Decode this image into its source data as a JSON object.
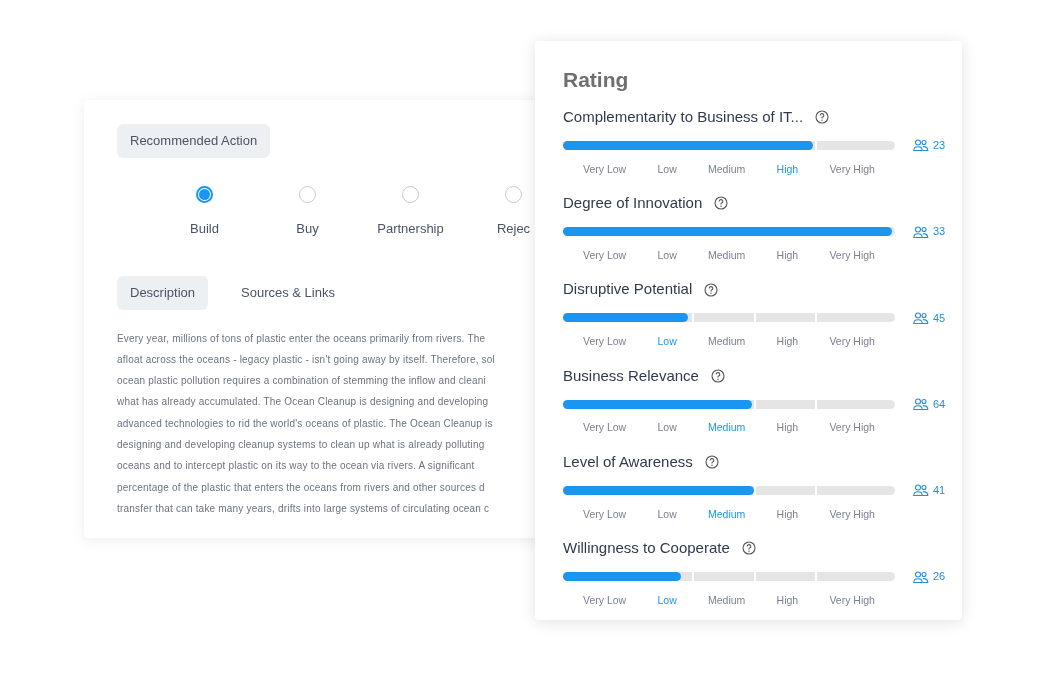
{
  "action_card": {
    "heading": "Recommended Action",
    "options": [
      {
        "label": "Build",
        "selected": true
      },
      {
        "label": "Buy",
        "selected": false
      },
      {
        "label": "Partnership",
        "selected": false
      },
      {
        "label": "Rejec",
        "selected": false
      }
    ],
    "tabs": [
      {
        "label": "Description",
        "selected": true
      },
      {
        "label": "Sources & Links",
        "selected": false
      }
    ],
    "description_lines": [
      "Every year, millions of tons of plastic enter the oceans primarily from rivers. The",
      "afloat across the oceans - legacy plastic - isn't going away by itself. Therefore, sol",
      "ocean plastic pollution requires a combination of stemming the inflow and cleani",
      "what has already accumulated. The Ocean Cleanup is designing and developing",
      "advanced technologies to rid the world's oceans of plastic. The Ocean Cleanup is",
      "designing and developing cleanup systems to clean up what is already polluting",
      "oceans and to intercept plastic on its way to the ocean via rivers. A significant",
      "percentage of the plastic that enters the oceans from rivers and other sources d",
      "transfer that can take many years, drifts into large systems of circulating ocean c"
    ]
  },
  "rating": {
    "title": "Rating",
    "criteria": [
      {
        "name": "Complementarity to Business of IT...",
        "level": 0.76,
        "count": "23",
        "scale": [
          {
            "label": "Very Low",
            "selected": false
          },
          {
            "label": "Low",
            "selected": false
          },
          {
            "label": "Medium",
            "selected": false
          },
          {
            "label": "High",
            "selected": true
          },
          {
            "label": "Very High",
            "selected": false
          }
        ]
      },
      {
        "name": "Degree of Innovation",
        "level": 1,
        "count": "33",
        "scale": [
          {
            "label": "Very Low",
            "selected": false
          },
          {
            "label": "Low",
            "selected": false
          },
          {
            "label": "Medium",
            "selected": false
          },
          {
            "label": "High",
            "selected": false
          },
          {
            "label": "Very High",
            "selected": false
          }
        ]
      },
      {
        "name": "Disruptive Potential",
        "level": 0.38,
        "count": "45",
        "scale": [
          {
            "label": "Very Low",
            "selected": false
          },
          {
            "label": "Low",
            "selected": true
          },
          {
            "label": "Medium",
            "selected": false
          },
          {
            "label": "High",
            "selected": false
          },
          {
            "label": "Very High",
            "selected": false
          }
        ]
      },
      {
        "name": "Business Relevance",
        "level": 0.575,
        "count": "64",
        "scale": [
          {
            "label": "Very Low",
            "selected": false
          },
          {
            "label": "Low",
            "selected": false
          },
          {
            "label": "Medium",
            "selected": true
          },
          {
            "label": "High",
            "selected": false
          },
          {
            "label": "Very High",
            "selected": false
          }
        ]
      },
      {
        "name": "Level of Awareness",
        "level": 0.58,
        "count": "41",
        "scale": [
          {
            "label": "Very Low",
            "selected": false
          },
          {
            "label": "Low",
            "selected": false
          },
          {
            "label": "Medium",
            "selected": true
          },
          {
            "label": "High",
            "selected": false
          },
          {
            "label": "Very High",
            "selected": false
          }
        ]
      },
      {
        "name": "Willingness to Cooperate",
        "level": 0.36,
        "count": "26",
        "scale": [
          {
            "label": "Very Low",
            "selected": false
          },
          {
            "label": "Low",
            "selected": true
          },
          {
            "label": "Medium",
            "selected": false
          },
          {
            "label": "High",
            "selected": false
          },
          {
            "label": "Very High",
            "selected": false
          }
        ]
      }
    ]
  }
}
